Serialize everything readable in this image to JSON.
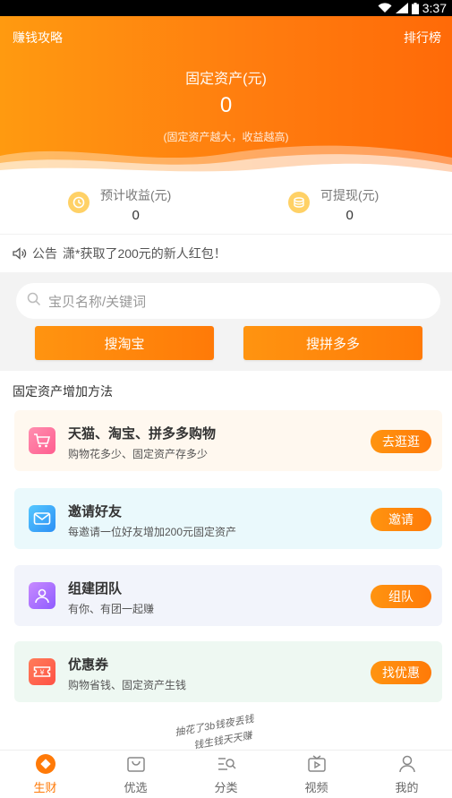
{
  "status_bar": {
    "time": "3:37",
    "icons": [
      "wifi-icon",
      "signal-icon",
      "battery-icon"
    ]
  },
  "header": {
    "left_link": "赚钱攻略",
    "right_link": "排行榜",
    "asset_title": "固定资产(元)",
    "asset_value": "0",
    "asset_tip": "(固定资产越大，收益越高)"
  },
  "stats": [
    {
      "label": "预计收益(元)",
      "value": "0",
      "icon": "clock-icon"
    },
    {
      "label": "可提现(元)",
      "value": "0",
      "icon": "coins-icon"
    }
  ],
  "notice": {
    "tag": "公告",
    "text": "潇*获取了200元的新人红包！",
    "icon": "speaker-icon"
  },
  "search": {
    "placeholder": "宝贝名称/关键词",
    "buttons": [
      "搜淘宝",
      "搜拼多多"
    ]
  },
  "methods": {
    "title": "固定资产增加方法",
    "items": [
      {
        "title": "天猫、淘宝、拼多多购物",
        "desc": "购物花多少、固定资产存多少",
        "action": "去逛逛",
        "icon": "cart-icon"
      },
      {
        "title": "邀请好友",
        "desc": "每邀请一位好友增加200元固定资产",
        "action": "邀请",
        "icon": "mail-icon"
      },
      {
        "title": "组建团队",
        "desc": "有你、有团一起赚",
        "action": "组队",
        "icon": "team-icon"
      },
      {
        "title": "优惠券",
        "desc": "购物省钱、固定资产生钱",
        "action": "找优惠",
        "icon": "coupon-icon"
      }
    ]
  },
  "slogan": {
    "line1": "抽花了3b钱夜丢钱",
    "line2": "钱生钱天天赚"
  },
  "tabs": [
    {
      "label": "生财",
      "icon": "diamond-icon",
      "active": true
    },
    {
      "label": "优选",
      "icon": "bag-icon",
      "active": false
    },
    {
      "label": "分类",
      "icon": "category-icon",
      "active": false
    },
    {
      "label": "视频",
      "icon": "video-icon",
      "active": false
    },
    {
      "label": "我的",
      "icon": "user-icon",
      "active": false
    }
  ],
  "colors": {
    "accent": "#ff7a08",
    "hero_start": "#ff9a10",
    "hero_end": "#ff6a08"
  }
}
